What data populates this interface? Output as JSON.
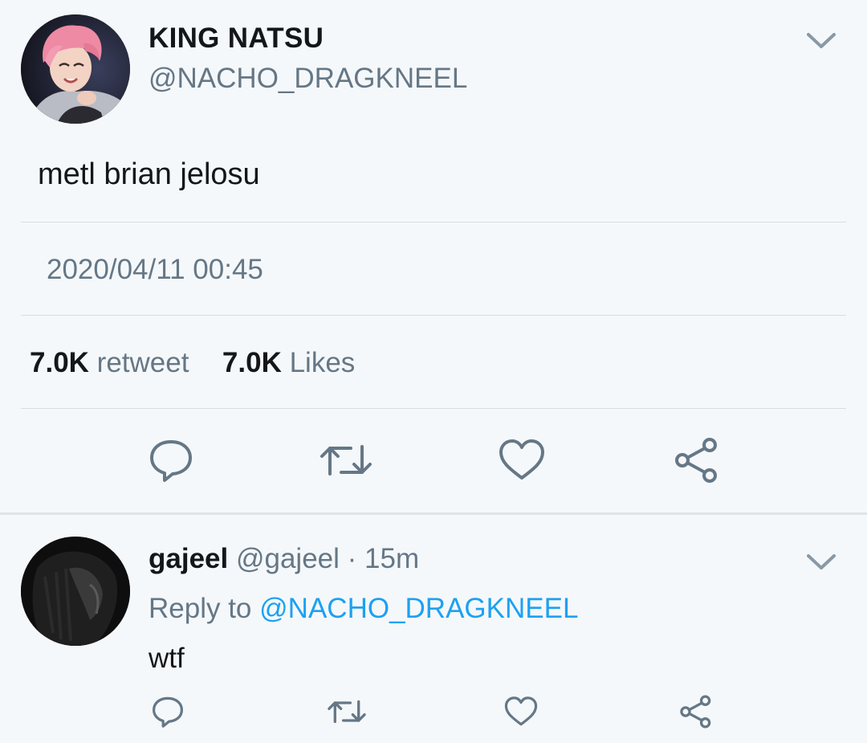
{
  "main_tweet": {
    "display_name": "KING NATSU",
    "handle": "@NACHO_DRAGKNEEL",
    "text": "metl brian jelosu",
    "timestamp": "2020/04/11 00:45",
    "stats": {
      "retweet_count": "7.0K",
      "retweet_label": "retweet",
      "like_count": "7.0K",
      "like_label": "Likes"
    },
    "actions": [
      "reply-icon",
      "retweet-icon",
      "like-icon",
      "share-icon"
    ]
  },
  "reply": {
    "display_name": "gajeel",
    "handle": "@gajeel",
    "separator": " · ",
    "time": "15m",
    "reply_to_label": "Reply to",
    "reply_to_user": "@NACHO_DRAGKNEEL",
    "text": "wtf",
    "actions": [
      "reply-icon",
      "retweet-icon",
      "like-icon",
      "share-icon"
    ]
  },
  "colors": {
    "background": "#f5f8fa",
    "text_primary": "#14171a",
    "text_secondary": "#657786",
    "link": "#1da1f2",
    "divider": "#d7dde2"
  }
}
